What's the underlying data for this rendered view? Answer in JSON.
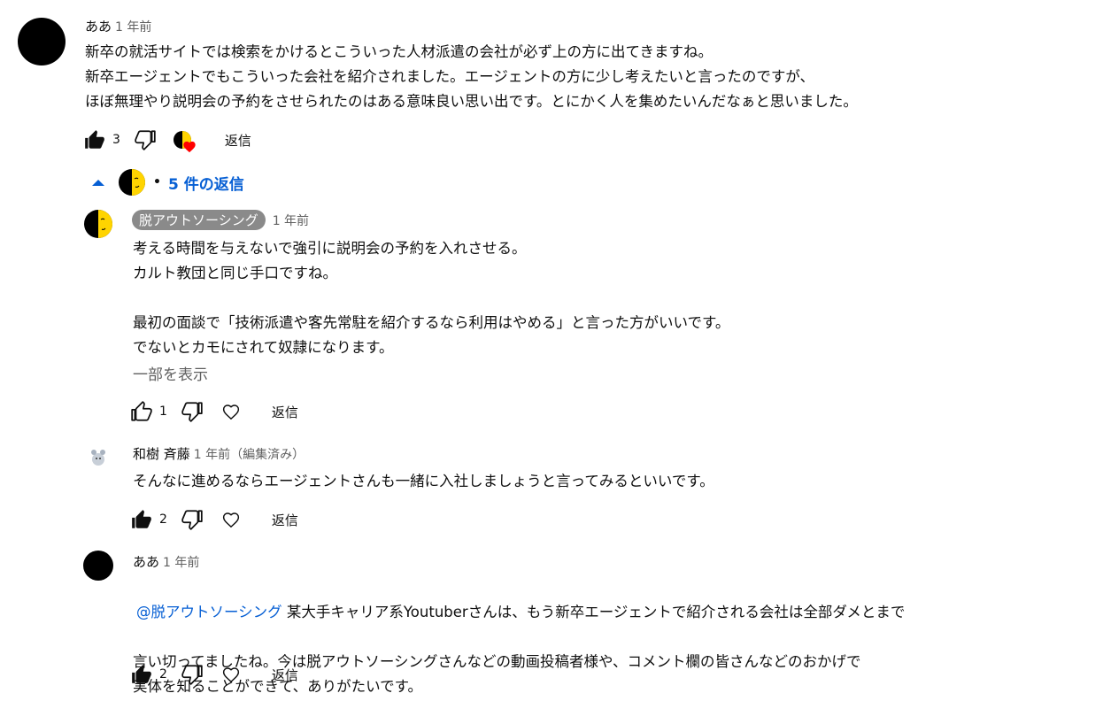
{
  "colors": {
    "link": "#065fd4",
    "meta": "#606060",
    "heart": "#ff0000",
    "chip": "#8a8a8a"
  },
  "top_comment": {
    "author": "ああ",
    "time": "1 年前",
    "text": "新卒の就活サイトでは検索をかけるとこういった人材派遣の会社が必ず上の方に出てきますね。\n新卒エージェントでもこういった会社を紹介されました。エージェントの方に少し考えたいと言ったのですが、\nほぼ無理やり説明会の予約をさせられたのはある意味良い思い出です。とにかく人を集めたいんだなぁと思いました。",
    "likes": "3",
    "reply_label": "返信",
    "icons": [
      "thumb-up-filled-icon",
      "thumb-down-icon",
      "creator-heart-icon",
      "chevron-up-icon"
    ]
  },
  "replies_toggle": {
    "label": "5 件の返信"
  },
  "replies": [
    {
      "author": "脱アウトソーシング",
      "time": "1 年前",
      "text": "考える時間を与えないで強引に説明会の予約を入れさせる。\nカルト教団と同じ手口ですね。\n\n最初の面談で「技術派遣や客先常駐を紹介するなら利用はやめる」と言った方がいいです。\nでないとカモにされて奴隷になります。",
      "show_more": "一部を表示",
      "likes": "1",
      "reply_label": "返信"
    },
    {
      "author": "和樹 斉藤",
      "time": "1 年前（編集済み）",
      "text": "そんなに進めるならエージェントさんも一緒に入社しましょうと言ってみるといいです。",
      "likes": "2",
      "reply_label": "返信"
    },
    {
      "author": "ああ",
      "time": "1 年前",
      "mention": "@脱アウトソーシング",
      "text_first": " 某大手キャリア系Youtuberさんは、もう新卒エージェントで紹介される会社は全部ダメとまで",
      "text_rest": "言い切ってましたね。今は脱アウトソーシングさんなどの動画投稿者様や、コメント欄の皆さんなどのおかげで\n実体を知ることができて、ありがたいです。",
      "likes": "2",
      "reply_label": "返信"
    }
  ]
}
